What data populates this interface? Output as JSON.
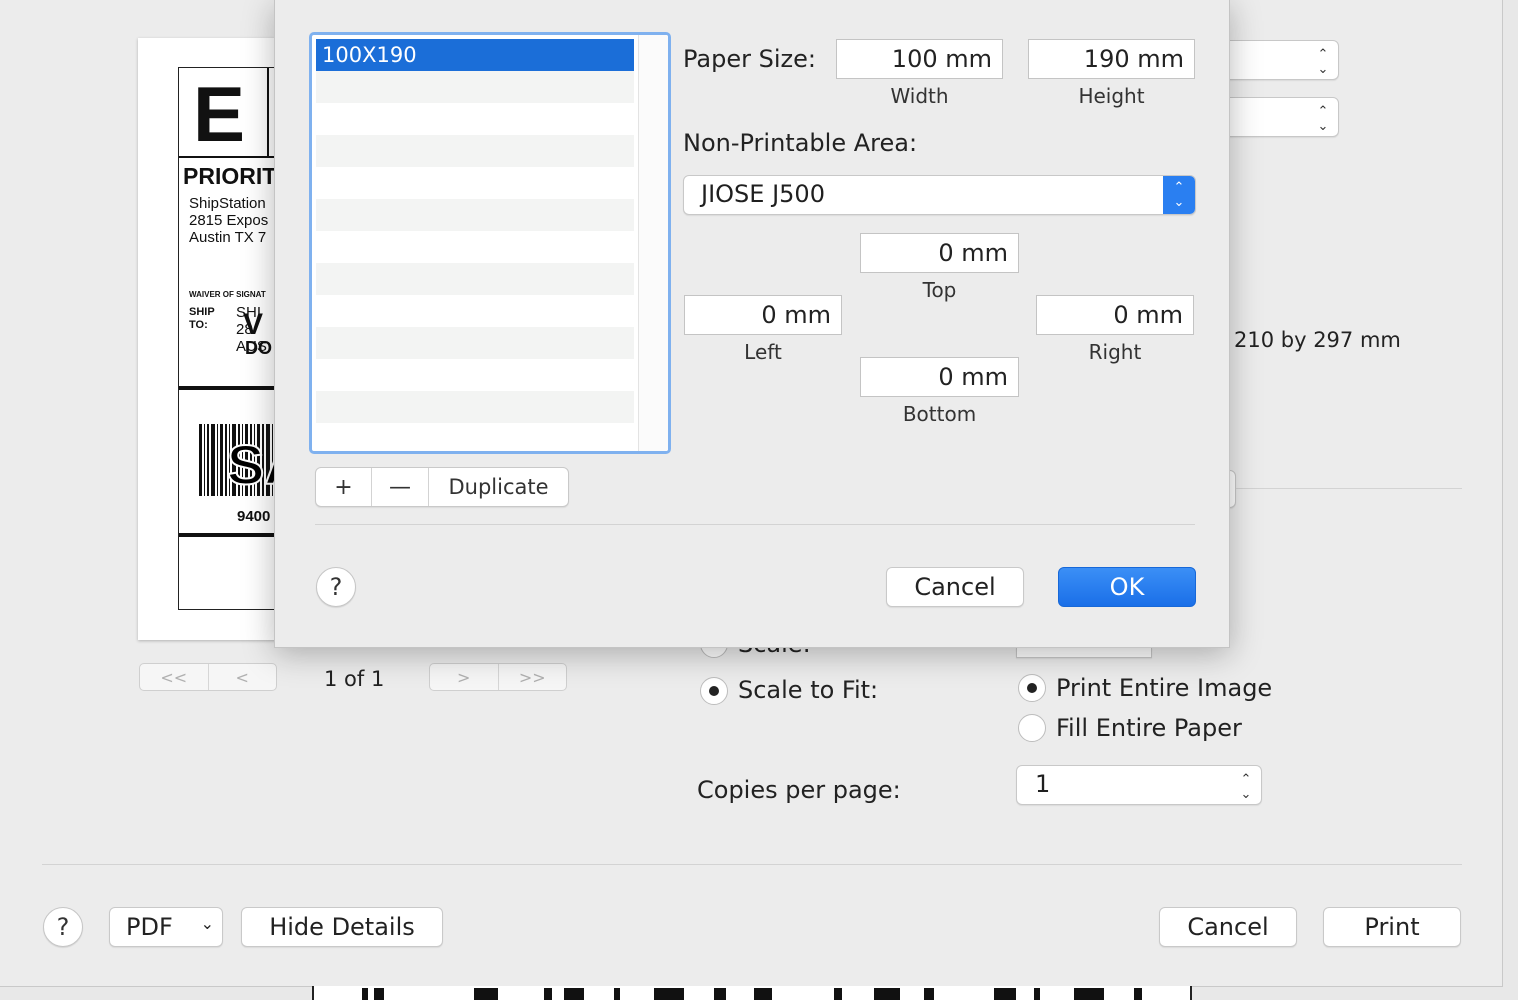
{
  "preview": {
    "label": {
      "service_letter": "E",
      "service_name": "PRIORIT",
      "from_lines": [
        "ShipStation",
        "2815 Expos",
        "Austin TX 7"
      ],
      "waiver": "WAIVER OF SIGNAT",
      "ship_to_label": [
        "SHIP",
        "TO:"
      ],
      "to_lines": [
        "SHI",
        "28",
        "AUS"
      ],
      "overlay_letters": [
        "V",
        "DO"
      ],
      "barcode_overlay": "SA",
      "tracking": "9400"
    },
    "page_indicator": "1 of 1",
    "nav": {
      "first": "<<",
      "prev": "<",
      "next": ">",
      "last": ">>"
    }
  },
  "print_dialog": {
    "paper_dimensions": "210 by 297 mm",
    "scale_label": "Scale:",
    "scale_to_fit_label": "Scale to Fit:",
    "scale_to_fit_selected": true,
    "print_entire_image_label": "Print Entire Image",
    "fill_entire_paper_label": "Fill Entire Paper",
    "print_entire_image_selected": true,
    "copies_per_page_label": "Copies per page:",
    "copies_per_page_value": "1",
    "pdf_label": "PDF",
    "hide_details_label": "Hide Details",
    "cancel_label": "Cancel",
    "print_label": "Print",
    "help_label": "?"
  },
  "custom_paper_sheet": {
    "paper_list": {
      "selected": "100X190",
      "items": [
        "100X190"
      ]
    },
    "add_label": "+",
    "remove_label": "—",
    "duplicate_label": "Duplicate",
    "paper_size_label": "Paper Size:",
    "width_value": "100 mm",
    "height_value": "190 mm",
    "width_caption": "Width",
    "height_caption": "Height",
    "non_printable_label": "Non-Printable Area:",
    "printer_value": "JIOSE J500",
    "top_value": "0 mm",
    "left_value": "0 mm",
    "right_value": "0 mm",
    "bottom_value": "0 mm",
    "top_caption": "Top",
    "left_caption": "Left",
    "right_caption": "Right",
    "bottom_caption": "Bottom",
    "help_label": "?",
    "cancel_label": "Cancel",
    "ok_label": "OK"
  },
  "colors": {
    "accent": "#1B6ED8",
    "list_focus": "#7FB1EF",
    "panel": "#ECECEC"
  }
}
